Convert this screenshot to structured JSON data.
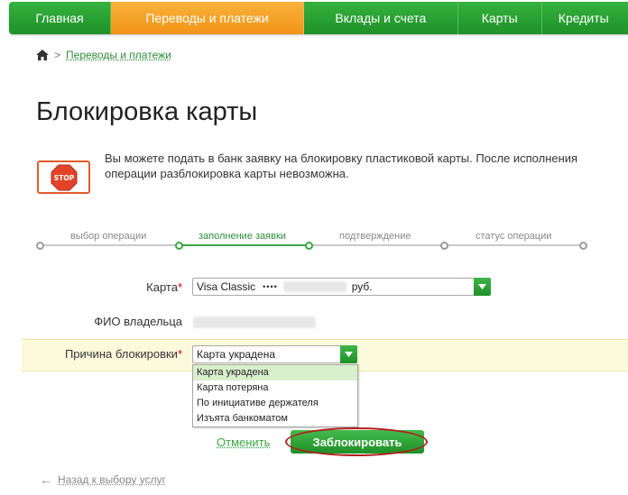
{
  "nav": {
    "items": [
      {
        "label": "Главная"
      },
      {
        "label": "Переводы и платежи"
      },
      {
        "label": "Вклады и счета"
      },
      {
        "label": "Карты"
      },
      {
        "label": "Кредиты"
      }
    ]
  },
  "breadcrumb": {
    "link": "Переводы и платежи",
    "separator": ">"
  },
  "page": {
    "title": "Блокировка карты"
  },
  "info": {
    "stop_label": "STOP",
    "text": "Вы можете подать в банк заявку на блокировку пластиковой карты. После исполнения операции разблокировка карты невозможна."
  },
  "steps": [
    {
      "label": "выбор операции"
    },
    {
      "label": "заполнение заявки"
    },
    {
      "label": "подтверждение"
    },
    {
      "label": "статус операции"
    }
  ],
  "form": {
    "card_label": "Карта",
    "card_value_prefix": "Visa Classic",
    "card_dots": "••••",
    "card_currency": "руб.",
    "owner_label": "ФИО владельца",
    "reason_label": "Причина блокировки",
    "reason_value": "Карта украдена",
    "reason_options": [
      "Карта украдена",
      "Карта потеряна",
      "По инициативе держателя",
      "Изъята банкоматом"
    ],
    "required_mark": "*"
  },
  "actions": {
    "cancel": "Отменить",
    "submit": "Заблокировать"
  },
  "back": {
    "label": "Назад к выбору услуг"
  },
  "colors": {
    "green": "#2f8d3a",
    "orange": "#f29418",
    "required": "#d0021b",
    "highlight": "#fdf9dc"
  }
}
